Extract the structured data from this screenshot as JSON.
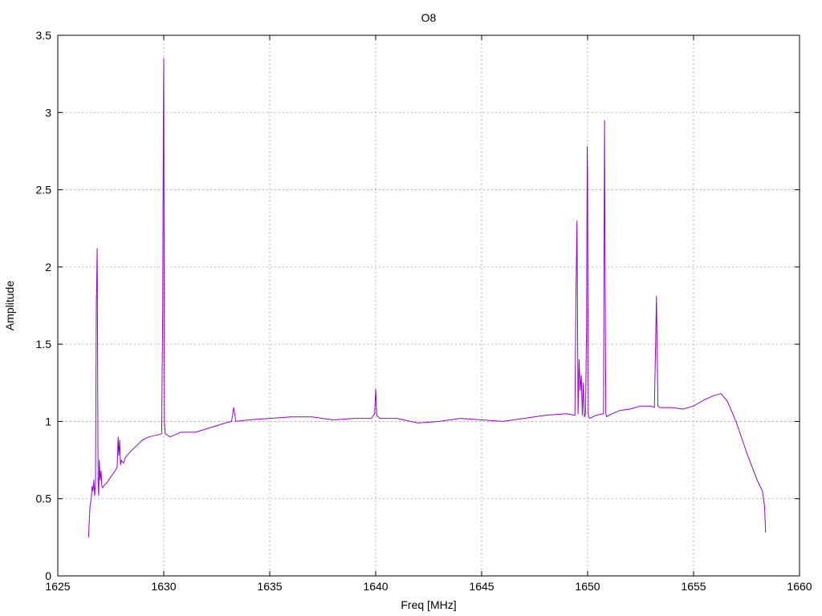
{
  "chart_data": {
    "type": "line",
    "title": "O8",
    "xlabel": "Freq [MHz]",
    "ylabel": "Amplitude",
    "xlim": [
      1625,
      1660
    ],
    "ylim": [
      0,
      3.5
    ],
    "xticks": [
      1625,
      1630,
      1635,
      1640,
      1645,
      1650,
      1655,
      1660
    ],
    "xtick_labels": [
      "1625",
      "1630",
      "1635",
      "1640",
      "1645",
      "1650",
      "1655",
      "1660"
    ],
    "yticks": [
      0,
      0.5,
      1,
      1.5,
      2,
      2.5,
      3,
      3.5
    ],
    "ytick_labels": [
      "0",
      "0.5",
      "1",
      "1.5",
      "2",
      "2.5",
      "3",
      "3.5"
    ],
    "grid": true,
    "series": [
      {
        "color": "#9400d3",
        "x": [
          1626.45,
          1626.52,
          1626.58,
          1626.62,
          1626.66,
          1626.7,
          1626.74,
          1626.78,
          1626.82,
          1626.86,
          1626.9,
          1626.93,
          1626.96,
          1627.0,
          1627.04,
          1627.08,
          1627.12,
          1627.2,
          1627.3,
          1627.45,
          1627.6,
          1627.8,
          1627.85,
          1627.88,
          1627.92,
          1627.96,
          1628.0,
          1628.04,
          1628.1,
          1628.2,
          1628.4,
          1628.7,
          1629.0,
          1629.3,
          1629.6,
          1629.9,
          1629.95,
          1629.98,
          1630.0,
          1630.03,
          1630.07,
          1630.3,
          1630.8,
          1631.5,
          1632.2,
          1632.9,
          1633.2,
          1633.3,
          1633.4,
          1634.0,
          1635.0,
          1636.0,
          1637.0,
          1638.0,
          1639.0,
          1639.8,
          1639.95,
          1640.0,
          1640.05,
          1640.2,
          1641.0,
          1642.0,
          1643.0,
          1644.0,
          1645.0,
          1646.0,
          1647.0,
          1648.0,
          1649.0,
          1649.4,
          1649.45,
          1649.5,
          1649.55,
          1649.6,
          1649.65,
          1649.7,
          1649.75,
          1649.8,
          1649.85,
          1649.9,
          1649.95,
          1649.98,
          1650.0,
          1650.03,
          1650.06,
          1650.1,
          1650.4,
          1650.75,
          1650.8,
          1650.83,
          1650.86,
          1650.9,
          1651.0,
          1651.5,
          1652.0,
          1652.5,
          1653.0,
          1653.15,
          1653.25,
          1653.32,
          1653.4,
          1654.0,
          1654.5,
          1655.0,
          1655.5,
          1656.0,
          1656.3,
          1656.6,
          1657.0,
          1657.5,
          1658.0,
          1658.25,
          1658.35,
          1658.4
        ],
        "values": [
          0.25,
          0.45,
          0.5,
          0.58,
          0.55,
          0.62,
          0.52,
          0.6,
          1.75,
          2.12,
          0.6,
          0.52,
          0.75,
          0.62,
          0.68,
          0.58,
          0.57,
          0.59,
          0.6,
          0.63,
          0.66,
          0.7,
          0.9,
          0.78,
          0.88,
          0.72,
          0.75,
          0.74,
          0.73,
          0.77,
          0.8,
          0.84,
          0.88,
          0.9,
          0.91,
          0.92,
          1.75,
          2.95,
          3.35,
          1.0,
          0.92,
          0.9,
          0.93,
          0.93,
          0.96,
          0.99,
          1.0,
          1.09,
          1.0,
          1.01,
          1.02,
          1.03,
          1.03,
          1.01,
          1.02,
          1.02,
          1.05,
          1.21,
          1.04,
          1.02,
          1.02,
          0.99,
          1.0,
          1.02,
          1.01,
          1.0,
          1.02,
          1.04,
          1.05,
          1.04,
          1.82,
          2.3,
          1.05,
          1.4,
          1.2,
          1.3,
          1.04,
          1.25,
          1.03,
          1.05,
          1.6,
          2.78,
          2.6,
          1.05,
          1.03,
          1.02,
          1.04,
          1.05,
          2.95,
          1.9,
          1.05,
          1.03,
          1.04,
          1.07,
          1.08,
          1.1,
          1.1,
          1.09,
          1.81,
          1.1,
          1.09,
          1.09,
          1.08,
          1.1,
          1.14,
          1.17,
          1.18,
          1.13,
          1.0,
          0.8,
          0.62,
          0.55,
          0.45,
          0.28
        ]
      }
    ]
  }
}
